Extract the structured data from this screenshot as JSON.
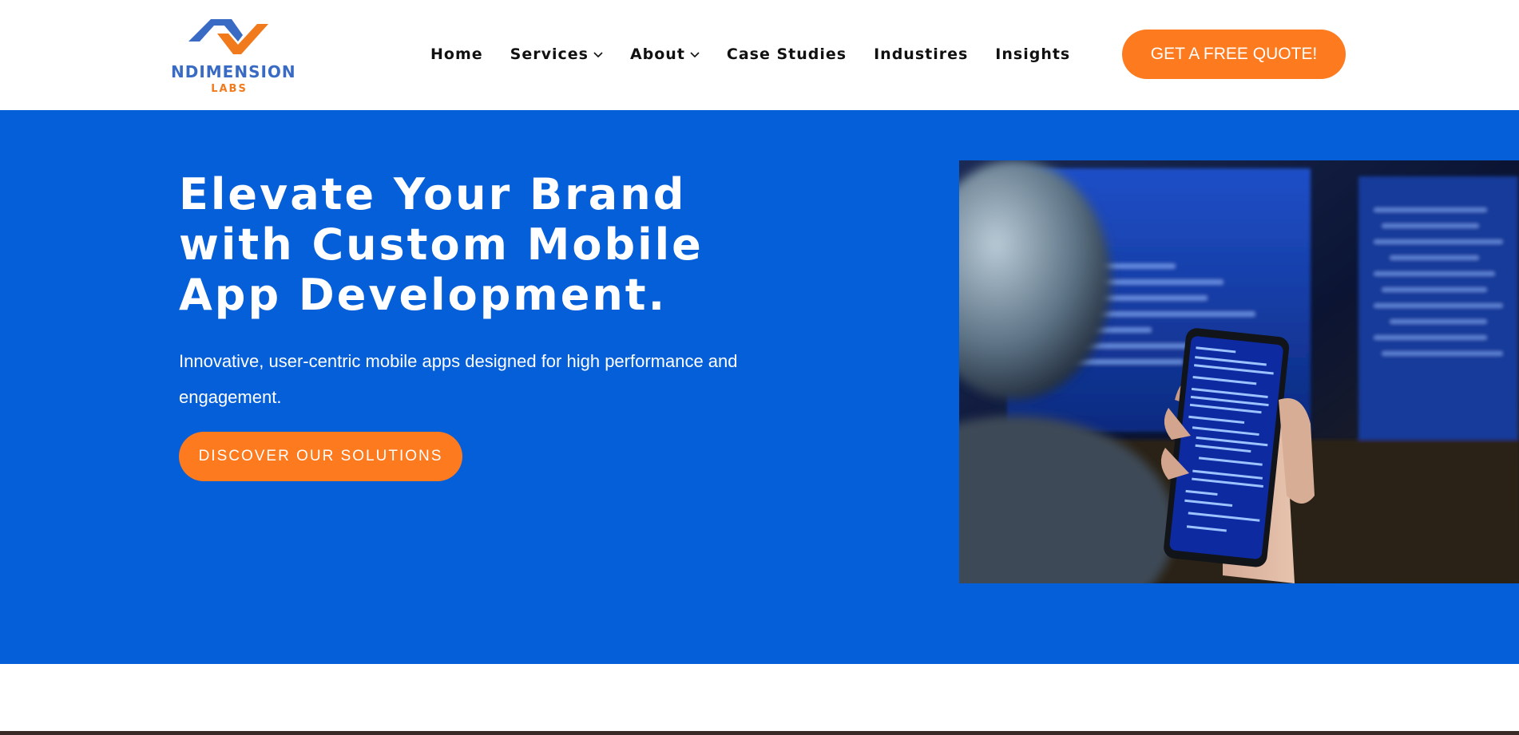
{
  "brand": {
    "name": "NDIMENSION",
    "sub": "LABS",
    "colors": {
      "primary": "#055fd9",
      "accent": "#fd7a1f",
      "logo_blue": "#3a6bc4",
      "logo_orange": "#f07a1c"
    }
  },
  "nav": {
    "items": [
      {
        "label": "Home",
        "has_dropdown": false
      },
      {
        "label": "Services",
        "has_dropdown": true,
        "icon": "chevron-down-icon"
      },
      {
        "label": "About",
        "has_dropdown": true,
        "icon": "chevron-down-icon"
      },
      {
        "label": "Case Studies",
        "has_dropdown": false
      },
      {
        "label": "Industires",
        "has_dropdown": false
      },
      {
        "label": "Insights",
        "has_dropdown": false
      }
    ]
  },
  "header": {
    "cta_label": "GET A FREE QUOTE!"
  },
  "hero": {
    "title": "Elevate Your Brand with Custom Mobile App Development.",
    "subtitle": "Innovative, user-centric mobile apps designed for high performance and engagement.",
    "cta_label": "DISCOVER OUR SOLUTIONS"
  }
}
